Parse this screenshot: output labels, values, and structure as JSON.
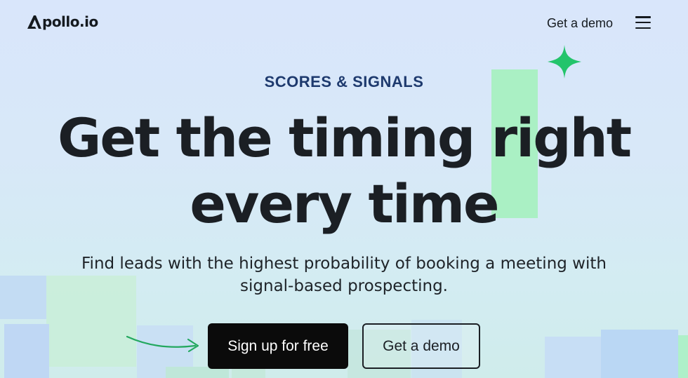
{
  "header": {
    "logo_text": "pollo.io",
    "nav_demo_label": "Get a demo",
    "menu_icon": "hamburger-menu-icon"
  },
  "hero": {
    "eyebrow": "SCORES & SIGNALS",
    "headline_line1": "Get the timing right",
    "headline_line2": "every time",
    "subhead_line1": "Find leads with the highest probability of booking a meeting with",
    "subhead_line2": "signal-based prospecting."
  },
  "cta": {
    "primary_label": "Sign up for free",
    "secondary_label": "Get a demo"
  },
  "colors": {
    "accent_green": "#23c46b",
    "block_green": "#aaf0c4",
    "eyebrow_blue": "#1e3a6e",
    "primary_button_bg": "#0b0b0b"
  },
  "icons": {
    "sparkle": "sparkle-icon",
    "arrow": "curved-arrow-icon",
    "logo": "apollo-logo-icon"
  }
}
